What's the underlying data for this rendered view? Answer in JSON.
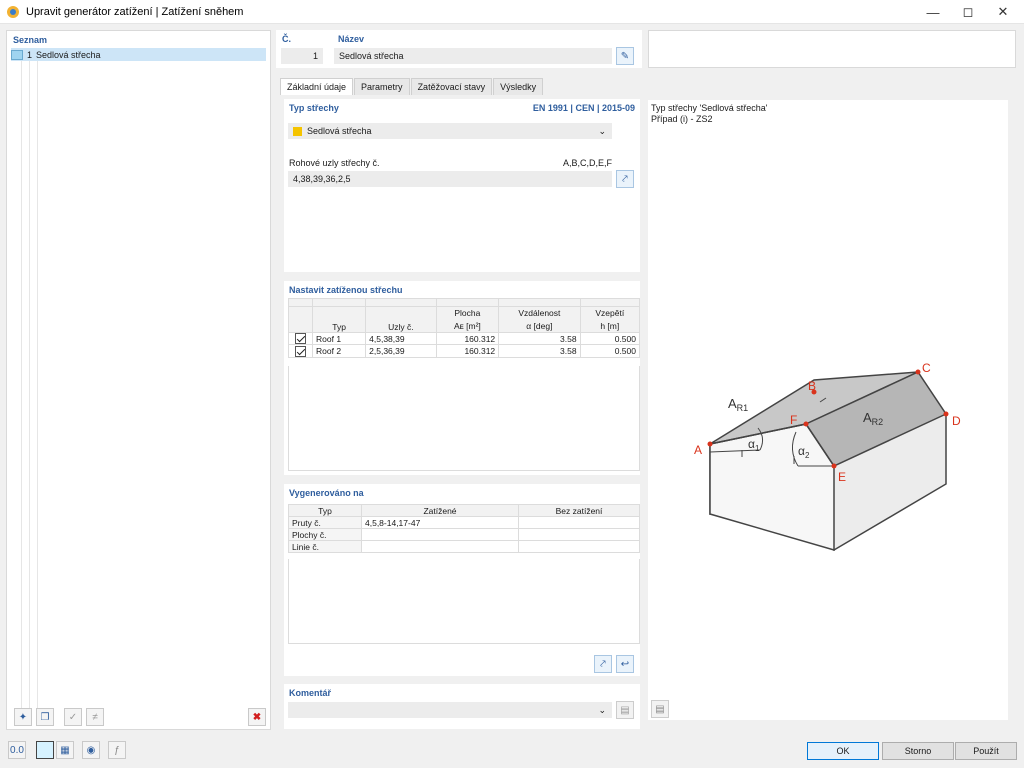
{
  "window": {
    "title": "Upravit generátor zatížení | Zatížení sněhem"
  },
  "list": {
    "header": "Seznam",
    "items": [
      {
        "no": "1",
        "label": "Sedlová střecha"
      }
    ]
  },
  "header": {
    "no_label": "Č.",
    "no_value": "1",
    "name_label": "Název",
    "name_value": "Sedlová střecha"
  },
  "tabs": [
    "Základní údaje",
    "Parametry",
    "Zatěžovací stavy",
    "Výsledky"
  ],
  "roof_type": {
    "title": "Typ střechy",
    "standard": "EN 1991 | CEN | 2015-09",
    "selected": "Sedlová střecha",
    "corner_label": "Rohové uzly střechy č.",
    "corner_hint": "A,B,C,D,E,F",
    "corner_value": "4,38,39,36,2,5"
  },
  "loaded_roof": {
    "title": "Nastavit zatíženou střechu",
    "columns": [
      "Typ",
      "Uzly č.",
      "Plocha",
      "Vzdálenost",
      "Vzepětí"
    ],
    "columns_sub": [
      "",
      "",
      "Aᴇ [m²]",
      "α [deg]",
      "h [m]"
    ],
    "rows": [
      {
        "typ": "Roof 1",
        "uzly": "4,5,38,39",
        "plocha": "160.312",
        "vzdalenost": "3.58",
        "vzepeti": "0.500"
      },
      {
        "typ": "Roof 2",
        "uzly": "2,5,36,39",
        "plocha": "160.312",
        "vzdalenost": "3.58",
        "vzepeti": "0.500"
      }
    ]
  },
  "generated": {
    "title": "Vygenerováno na",
    "columns": [
      "Typ",
      "Zatížené",
      "Bez zatížení"
    ],
    "rows": [
      {
        "typ": "Pruty č.",
        "loaded": "4,5,8-14,17-47",
        "unloaded": ""
      },
      {
        "typ": "Plochy č.",
        "loaded": "",
        "unloaded": ""
      },
      {
        "typ": "Linie č.",
        "loaded": "",
        "unloaded": ""
      }
    ]
  },
  "comment": {
    "title": "Komentář",
    "value": ""
  },
  "preview": {
    "line1": "Typ střechy 'Sedlová střecha'",
    "line2": "Případ (i) - ZS2",
    "labels": {
      "A": "A",
      "B": "B",
      "C": "C",
      "D": "D",
      "E": "E",
      "F": "F",
      "AR1": "A",
      "AR1_sub": "R1",
      "AR2": "A",
      "AR2_sub": "R2",
      "a1": "α",
      "a1_sub": "1",
      "a2": "α",
      "a2_sub": "2"
    }
  },
  "buttons": {
    "ok": "OK",
    "cancel": "Storno",
    "apply": "Použít"
  },
  "colors": {
    "accent": "#2f5e9e",
    "roof_swatch": "#f5c400",
    "node": "#d9331c",
    "list_select": "#cde5f7"
  }
}
